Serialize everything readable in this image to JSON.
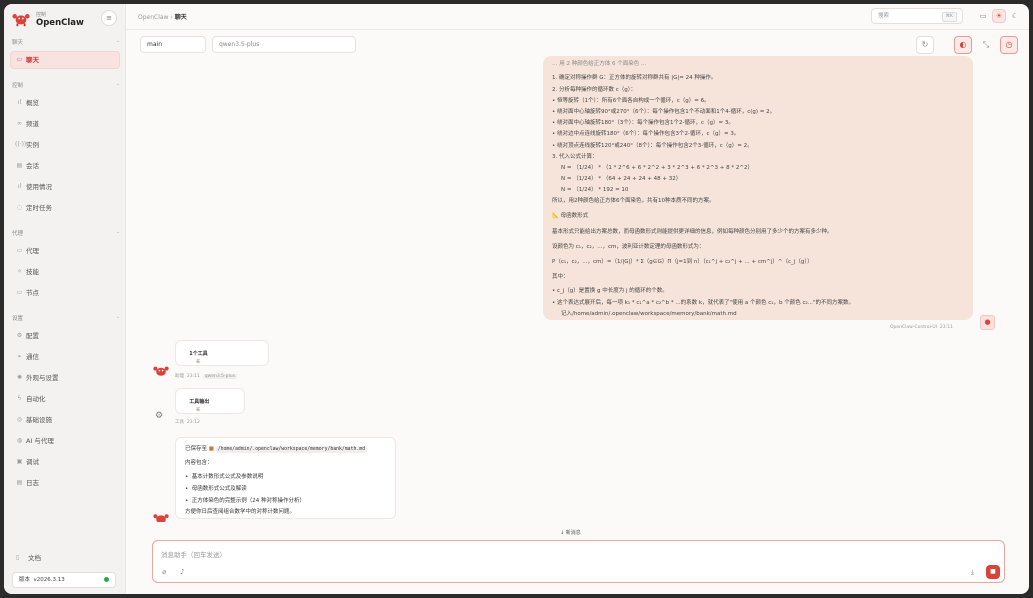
{
  "brand": {
    "subtitle": "控制",
    "name": "OpenClaw",
    "collapse_icon": "menu-icon"
  },
  "sidebar": {
    "sections": {
      "chat": "聊天",
      "control": "控制",
      "agent": "代理",
      "settings": "设置"
    },
    "items": {
      "chat": "聊天",
      "overview": "概览",
      "channels": "频道",
      "instances": "实例",
      "sessions": "会话",
      "usage": "使用情况",
      "cron": "定时任务",
      "agents": "代理",
      "skills": "技能",
      "nodes": "节点",
      "config": "配置",
      "comms": "通信",
      "appearance": "外观与设置",
      "automation": "自动化",
      "infra": "基础设施",
      "ai_agents": "AI 与代理",
      "debug": "调试",
      "logs": "日志"
    },
    "docs": "文档",
    "version_label": "版本",
    "version": "v2026.3.13"
  },
  "header": {
    "breadcrumb_root": "OpenClaw",
    "breadcrumb_sep": "›",
    "breadcrumb_current": "聊天",
    "search_placeholder": "搜索",
    "search_kbd": "⌘K"
  },
  "toolbar": {
    "session": "main",
    "model": "qwen3.5-plus"
  },
  "user_message": {
    "lines": [
      "1. 确定对称操作群 G：正方体的旋转对称群共有 |G|= 24 种操作。",
      "2. 分析每种操作的循环数 c（g）：",
      "• 恒等旋转（1个）：所有6个面各自构成一个循环，c（g）= 6。",
      "• 绕对面中心轴旋转90°或270°（6个）：每个操作包含1个不动面和1个4-循环，c(g) = 2。",
      "• 绕对面中心轴旋转180°（3个）：每个操作包含1个2-循环，c（g）= 3。",
      "• 绕对边中点连线旋转180°（6个）：每个操作包含3个2-循环，c（g）= 3。",
      "• 绕对顶点连线旋转120°或240°（8个）：每个操作包含2个3-循环，c（g）= 2。",
      "3. 代入公式计算：",
      "N = （1/24） * （1 * 2^6 + 6 * 2^2 + 3 * 2^3 + 6 * 2^3 + 8 * 2^2）",
      "N = （1/24） * （64 + 24 + 24 + 48 + 32）",
      "N = （1/24） * 192 = 10",
      "所以，用2种颜色给正方体6个面染色，共有10种本质不同的方案。",
      "📐 母函数形式",
      "基本形式只能给出方案总数，而母函数形式则能提供更详细的信息，例如每种颜色分别用了多少个的方案有多少种。",
      "设颜色为 c₁，c₂，...，cm，波利亚计数定理的母函数形式为：",
      "P（c₁，c₂，...，cm）=（1/|G|）* Σ（g∈G）Π（j=1到 n）（c₁^j + c₂^j + ... + cm^j）^（c_j（g））",
      "其中：",
      "• c_j（g）是置换 g 中长度为 j 的循环的个数。",
      "• 这个表达式展开后，每一项 k₁ * c₁^a * c₂^b * ...的系数 k，就代表了\"使用 a 个颜色 c₁，b 个颜色 c₂...\"的不同方案数。",
      "记入/home/admin/.openclaw/workspace/memory/bank/math.md"
    ],
    "sender": "OpenClaw-Control-UI",
    "time": "23:11"
  },
  "assistant": {
    "tool_call_label": "1个工具",
    "tool_output_label": "工具输出",
    "agent_name": "助理",
    "agent_time": "23:11",
    "agent_model": "qwen3.5-plus",
    "tool_name": "工具",
    "tool_time": "23:12",
    "reply_saved_prefix": "已保存至",
    "reply_path": "/home/admin/.openclaw/workspace/memory/bank/math.md",
    "reply_contents_label": "内容包含：",
    "reply_items": [
      "基本计数形式公式及参数说明",
      "母函数形式公式及解读",
      "正方体染色的完整示例（24 种对称操作分析）"
    ],
    "reply_footer": "方便你日后查阅组合数学中的对称计数问题。"
  },
  "new_messages": "新消息",
  "composer": {
    "placeholder": "消息助手（回车发送）"
  }
}
